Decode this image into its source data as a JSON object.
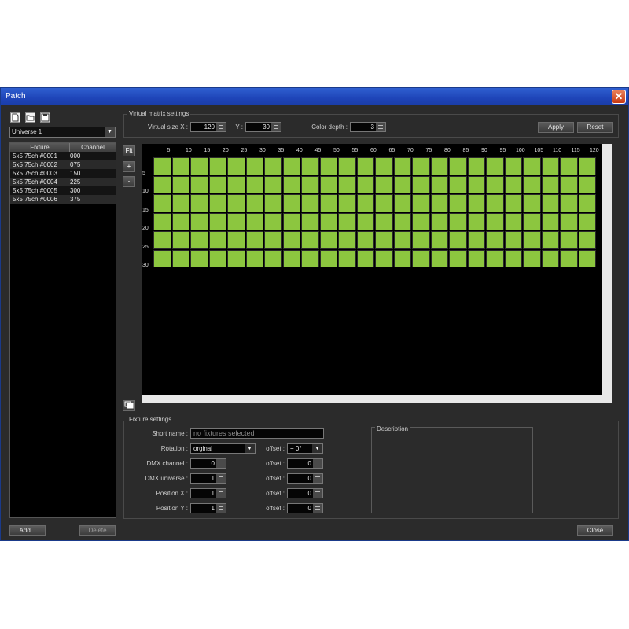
{
  "window": {
    "title": "Patch"
  },
  "toolbar": {
    "icons": [
      "new-file-icon",
      "open-folder-icon",
      "save-disk-icon"
    ]
  },
  "universe_select": {
    "value": "Universe 1"
  },
  "fixture_list": {
    "headers": [
      "Fixture",
      "Channel"
    ],
    "rows": [
      {
        "fixture": "5x5 75ch #0001",
        "channel": "000"
      },
      {
        "fixture": "5x5 75ch #0002",
        "channel": "075"
      },
      {
        "fixture": "5x5 75ch #0003",
        "channel": "150"
      },
      {
        "fixture": "5x5 75ch #0004",
        "channel": "225"
      },
      {
        "fixture": "5x5 75ch #0005",
        "channel": "300"
      },
      {
        "fixture": "5x5 75ch #0006",
        "channel": "375"
      }
    ]
  },
  "virtual_matrix": {
    "group_label": "Virtual matrix settings",
    "size_x_label": "Virtual size X :",
    "size_x": "120",
    "y_label": "Y :",
    "size_y": "30",
    "color_depth_label": "Color depth :",
    "color_depth": "3",
    "apply": "Apply",
    "reset": "Reset"
  },
  "view_buttons": {
    "fit": "Fit",
    "zoom_in": "+",
    "zoom_out": "-"
  },
  "ruler": {
    "x": [
      "5",
      "10",
      "15",
      "20",
      "25",
      "30",
      "35",
      "40",
      "45",
      "50",
      "55",
      "60",
      "65",
      "70",
      "75",
      "80",
      "85",
      "90",
      "95",
      "100",
      "105",
      "110",
      "115",
      "120"
    ],
    "y": [
      "5",
      "10",
      "15",
      "20",
      "25",
      "30"
    ]
  },
  "grid": {
    "columns": 24,
    "rows": 6,
    "cell_color": "#8cc63f"
  },
  "fixture_settings": {
    "group_label": "Fixture settings",
    "short_name_label": "Short name :",
    "short_name_placeholder": "no fixtures selected",
    "rotation_label": "Rotation :",
    "rotation_value": "orginal",
    "rotation_offset_label": "offset :",
    "rotation_offset_value": "+ 0°",
    "dmx_channel_label": "DMX channel :",
    "dmx_channel": "0",
    "dmx_channel_offset_label": "offset :",
    "dmx_channel_offset": "0",
    "dmx_universe_label": "DMX universe :",
    "dmx_universe": "1",
    "dmx_universe_offset_label": "offset :",
    "dmx_universe_offset": "0",
    "position_x_label": "Position X :",
    "position_x": "1",
    "position_x_offset_label": "offset :",
    "position_x_offset": "0",
    "position_y_label": "Position Y :",
    "position_y": "1",
    "position_y_offset_label": "offset :",
    "position_y_offset": "0",
    "description_label": "Description"
  },
  "footer": {
    "add": "Add...",
    "delete": "Delete",
    "close": "Close"
  }
}
